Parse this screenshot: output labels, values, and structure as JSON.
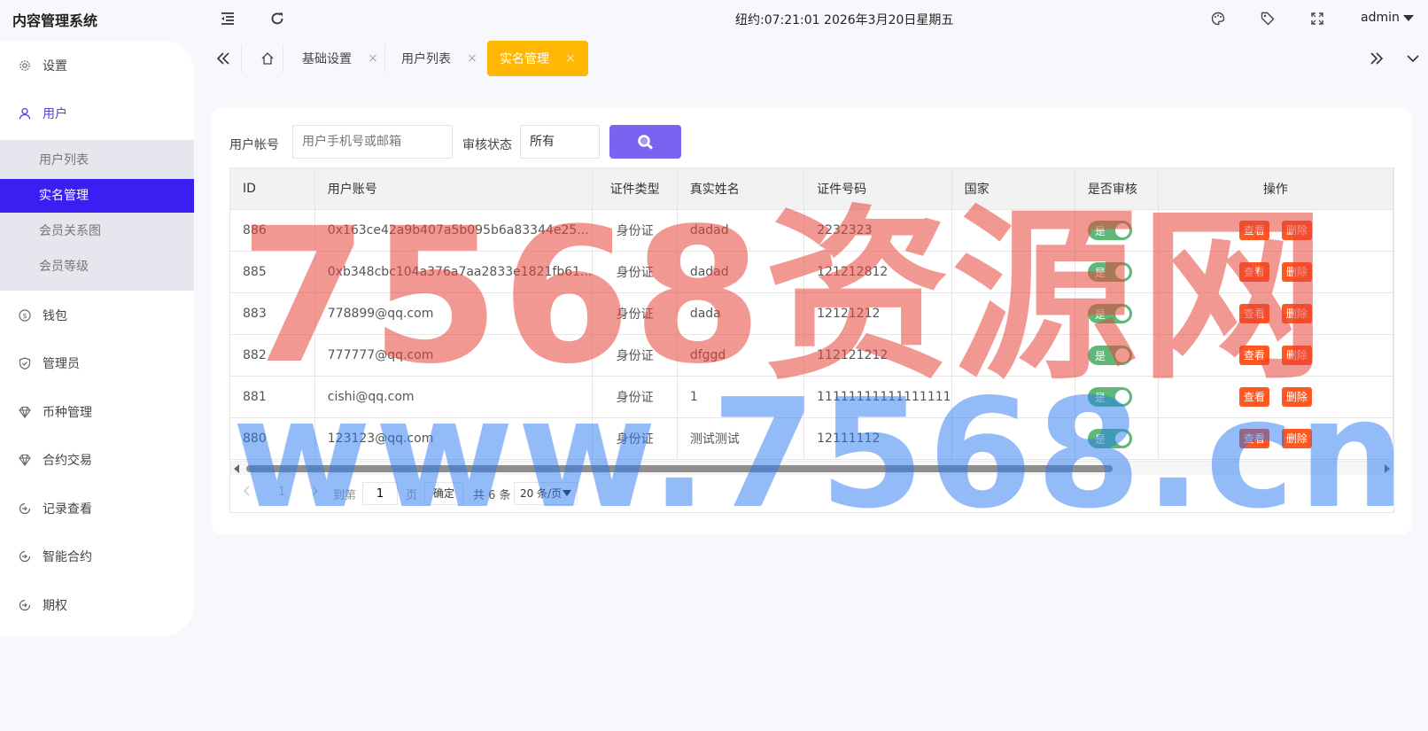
{
  "header": {
    "brand": "内容管理系统",
    "clock": "纽约:07:21:01 2026年3月20日星期五",
    "user": "admin"
  },
  "sidebar": {
    "items": [
      {
        "label": "设置",
        "icon": "gear-icon"
      },
      {
        "label": "用户",
        "icon": "user-icon"
      },
      {
        "label": "钱包",
        "icon": "coin-icon"
      },
      {
        "label": "管理员",
        "icon": "shield-icon"
      },
      {
        "label": "币种管理",
        "icon": "diamond-icon"
      },
      {
        "label": "合约交易",
        "icon": "diamond-icon"
      },
      {
        "label": "记录查看",
        "icon": "circle-arrow-icon"
      },
      {
        "label": "智能合约",
        "icon": "circle-arrow-icon"
      },
      {
        "label": "期权",
        "icon": "circle-arrow-icon"
      }
    ],
    "user_sub": [
      "用户列表",
      "实名管理",
      "会员关系图",
      "会员等级"
    ]
  },
  "tabs": [
    "基础设置",
    "用户列表",
    "实名管理"
  ],
  "filter": {
    "account_label": "用户帐号",
    "account_placeholder": "用户手机号或邮箱",
    "status_label": "审核状态",
    "status_value": "所有"
  },
  "table": {
    "columns": [
      "ID",
      "用户账号",
      "证件类型",
      "真实姓名",
      "证件号码",
      "国家",
      "是否审核",
      "操作"
    ],
    "rows": [
      {
        "id": "886",
        "account": "0x163ce42a9b407a5b095b6a83344e25...",
        "doc_type": "身份证",
        "name": "dadad",
        "doc_no": "2232323",
        "country": "",
        "audit": "是"
      },
      {
        "id": "885",
        "account": "0xb348cbc104a376a7aa2833e1821fb61...",
        "doc_type": "身份证",
        "name": "dadad",
        "doc_no": "121212812",
        "country": "",
        "audit": "是"
      },
      {
        "id": "883",
        "account": "778899@qq.com",
        "doc_type": "身份证",
        "name": "dada",
        "doc_no": "12121212",
        "country": "",
        "audit": "是"
      },
      {
        "id": "882",
        "account": "777777@qq.com",
        "doc_type": "身份证",
        "name": "dfggd",
        "doc_no": "112121212",
        "country": "",
        "audit": "是"
      },
      {
        "id": "881",
        "account": "cishi@qq.com",
        "doc_type": "身份证",
        "name": "1",
        "doc_no": "11111111111111111",
        "country": "",
        "audit": "是"
      },
      {
        "id": "880",
        "account": "123123@qq.com",
        "doc_type": "身份证",
        "name": "测试测试",
        "doc_no": "12111112",
        "country": "",
        "audit": "是"
      }
    ],
    "view_label": "查看",
    "delete_label": "删除"
  },
  "pager": {
    "current_page": "1",
    "goto_label": "到第",
    "goto_value": "1",
    "page_unit": "页",
    "confirm_label": "确定",
    "total_text": "共 6 条",
    "page_size": "20 条/页"
  },
  "watermark": {
    "line1": "7568资源网",
    "line2": "www.7568.cn"
  },
  "colors": {
    "accent": "#3b1ff2",
    "tab_active": "#ffb703",
    "search_button": "#7a63f0",
    "danger": "#ff5722",
    "toggle_on": "#5fb878"
  }
}
